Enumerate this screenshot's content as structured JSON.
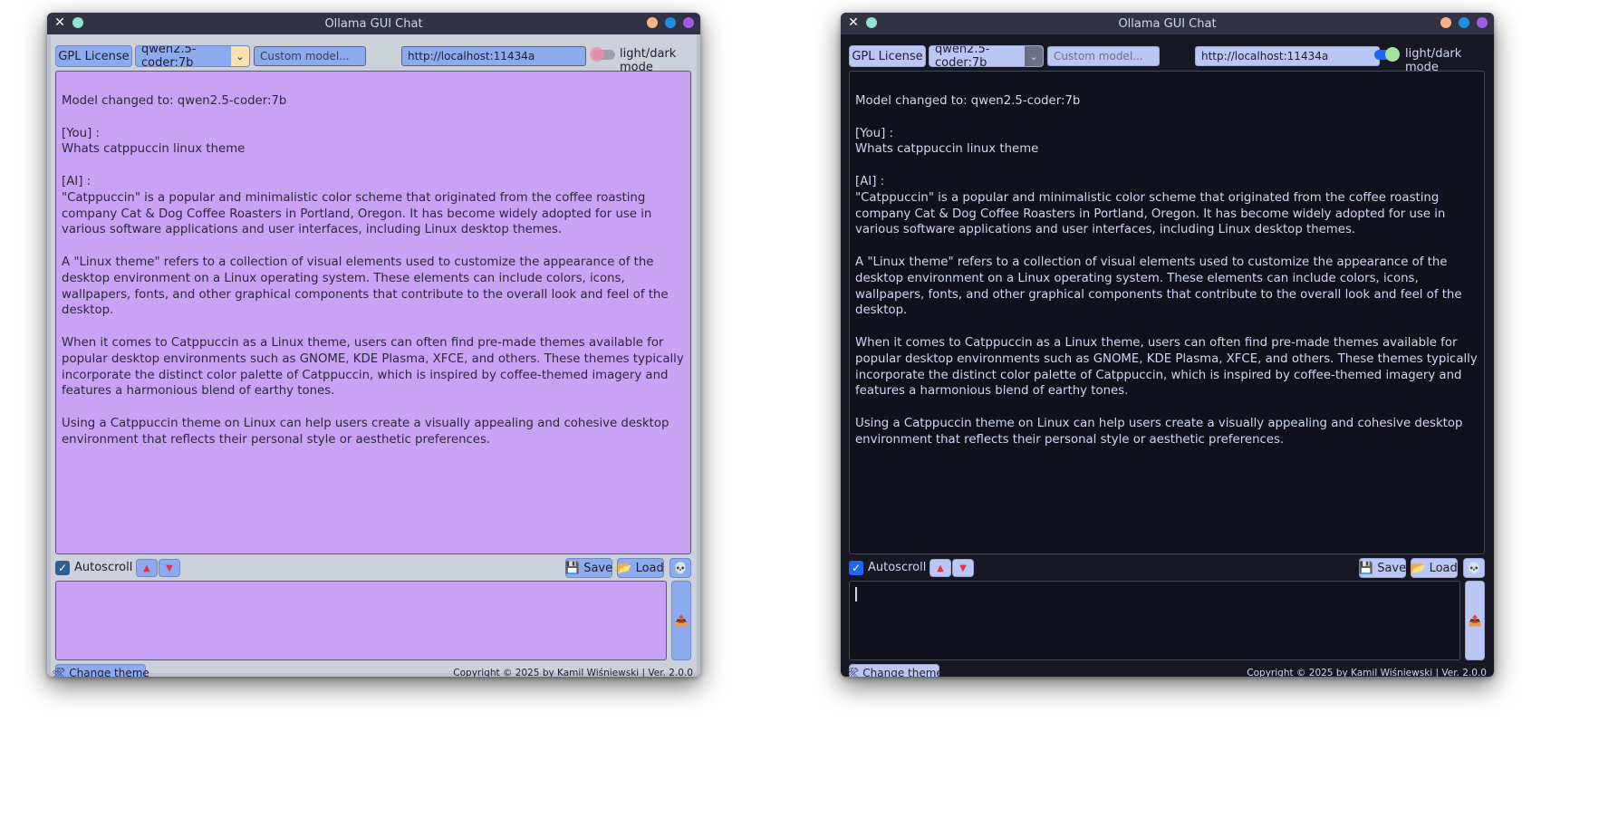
{
  "window": {
    "title": "Ollama GUI Chat",
    "close_glyph": "✕",
    "buttons": [
      {
        "name": "minimize",
        "color": "#fab387"
      },
      {
        "name": "maximize",
        "color": "#1e90e0"
      },
      {
        "name": "close",
        "color": "#a05ce0"
      }
    ],
    "left_dot_color": "#94e2d5"
  },
  "toolbar": {
    "gpl_label": "GPL License",
    "model_value": "qwen2.5-coder:7b",
    "model_arrow": "⌄",
    "custom_model_placeholder": "Custom model...",
    "url_value": "http://localhost:11434a",
    "mode_label": "light/dark mode"
  },
  "chat": {
    "lines": [
      "Model changed to: qwen2.5-coder:7b",
      "[You] :\nWhats catppuccin linux theme",
      "[AI] :\n\"Catppuccin\" is a popular and minimalistic color scheme that originated from the coffee roasting company Cat & Dog Coffee Roasters in Portland, Oregon. It has become widely adopted for use in various software applications and user interfaces, including Linux desktop themes.",
      "A \"Linux theme\" refers to a collection of visual elements used to customize the appearance of the desktop environment on a Linux operating system. These elements can include colors, icons, wallpapers, fonts, and other graphical components that contribute to the overall look and feel of the desktop.",
      "When it comes to Catppuccin as a Linux theme, users can often find pre-made themes available for popular desktop environments such as GNOME, KDE Plasma, XFCE, and others. These themes typically incorporate the distinct color palette of Catppuccin, which is inspired by coffee-themed imagery and features a harmonious blend of earthy tones.",
      "Using a Catppuccin theme on Linux can help users create a visually appealing and cohesive desktop environment that reflects their personal style or aesthetic preferences."
    ]
  },
  "controls": {
    "autoscroll_label": "Autoscroll",
    "checkbox_glyph": "✓",
    "up_glyph": "▲",
    "down_glyph": "▼",
    "save_label": "💾 Save",
    "load_label": "📂 Load",
    "skull_glyph": "💀",
    "send_glyph": "📤"
  },
  "footer": {
    "change_theme_label": "🛠 Change theme",
    "copyright": "Copyright © 2025 by Kamil Wiśniewski | Ver. 2.0.0"
  },
  "themes": {
    "light": {
      "chat_bg": "#caa2f5",
      "content_bg": "#ccd0da",
      "button_bg": "#8caaee",
      "toggle_on": false
    },
    "dark": {
      "chat_bg": "#11111b",
      "content_bg": "#181825",
      "button_bg": "#bac7f5",
      "toggle_on": true
    }
  }
}
